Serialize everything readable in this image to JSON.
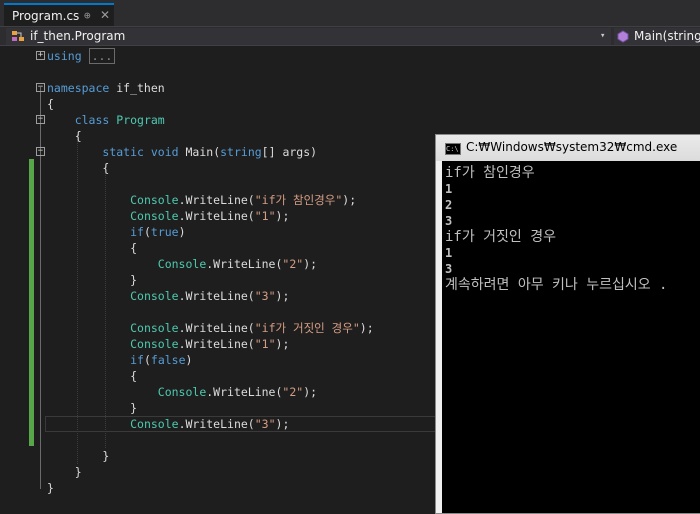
{
  "tab": {
    "title": "Program.cs",
    "pin_glyph": "⊕",
    "close_glyph": "✕"
  },
  "navbar": {
    "left_text": "if_then.Program",
    "right_text": "Main(string[]",
    "dropdown_glyph": "▾"
  },
  "editor": {
    "lines": [
      {
        "id": "l1",
        "parts": [
          [
            "kw",
            "using"
          ],
          [
            "plain",
            " "
          ],
          [
            "collapsed",
            "..."
          ]
        ]
      },
      {
        "id": "l2",
        "parts": []
      },
      {
        "id": "l3",
        "parts": [
          [
            "kw",
            "namespace"
          ],
          [
            "plain",
            " if_then"
          ]
        ]
      },
      {
        "id": "l4",
        "parts": [
          [
            "plain",
            "{"
          ]
        ]
      },
      {
        "id": "l5",
        "parts": [
          [
            "plain",
            "    "
          ],
          [
            "kw",
            "class"
          ],
          [
            "plain",
            " "
          ],
          [
            "cls",
            "Program"
          ]
        ]
      },
      {
        "id": "l6",
        "parts": [
          [
            "plain",
            "    {"
          ]
        ]
      },
      {
        "id": "l7",
        "parts": [
          [
            "plain",
            "        "
          ],
          [
            "kw",
            "static"
          ],
          [
            "plain",
            " "
          ],
          [
            "kw",
            "void"
          ],
          [
            "plain",
            " Main("
          ],
          [
            "kw",
            "string"
          ],
          [
            "plain",
            "[] args)"
          ]
        ]
      },
      {
        "id": "l8",
        "parts": [
          [
            "plain",
            "        {"
          ]
        ]
      },
      {
        "id": "l9",
        "parts": []
      },
      {
        "id": "l10",
        "parts": [
          [
            "plain",
            "            "
          ],
          [
            "cls",
            "Console"
          ],
          [
            "plain",
            ".WriteLine("
          ],
          [
            "str",
            "\"if가 참인경우\""
          ],
          [
            "plain",
            ");"
          ]
        ]
      },
      {
        "id": "l11",
        "parts": [
          [
            "plain",
            "            "
          ],
          [
            "cls",
            "Console"
          ],
          [
            "plain",
            ".WriteLine("
          ],
          [
            "str",
            "\"1\""
          ],
          [
            "plain",
            ");"
          ]
        ]
      },
      {
        "id": "l12",
        "parts": [
          [
            "plain",
            "            "
          ],
          [
            "kw",
            "if"
          ],
          [
            "plain",
            "("
          ],
          [
            "kw",
            "true"
          ],
          [
            "plain",
            ")"
          ]
        ]
      },
      {
        "id": "l13",
        "parts": [
          [
            "plain",
            "            {"
          ]
        ]
      },
      {
        "id": "l14",
        "parts": [
          [
            "plain",
            "                "
          ],
          [
            "cls",
            "Console"
          ],
          [
            "plain",
            ".WriteLine("
          ],
          [
            "str",
            "\"2\""
          ],
          [
            "plain",
            ");"
          ]
        ]
      },
      {
        "id": "l15",
        "parts": [
          [
            "plain",
            "            }"
          ]
        ]
      },
      {
        "id": "l16",
        "parts": [
          [
            "plain",
            "            "
          ],
          [
            "cls",
            "Console"
          ],
          [
            "plain",
            ".WriteLine("
          ],
          [
            "str",
            "\"3\""
          ],
          [
            "plain",
            ");"
          ]
        ]
      },
      {
        "id": "l17",
        "parts": []
      },
      {
        "id": "l18",
        "parts": [
          [
            "plain",
            "            "
          ],
          [
            "cls",
            "Console"
          ],
          [
            "plain",
            ".WriteLine("
          ],
          [
            "str",
            "\"if가 거짓인 경우\""
          ],
          [
            "plain",
            ");"
          ]
        ]
      },
      {
        "id": "l19",
        "parts": [
          [
            "plain",
            "            "
          ],
          [
            "cls",
            "Console"
          ],
          [
            "plain",
            ".WriteLine("
          ],
          [
            "str",
            "\"1\""
          ],
          [
            "plain",
            ");"
          ]
        ]
      },
      {
        "id": "l20",
        "parts": [
          [
            "plain",
            "            "
          ],
          [
            "kw",
            "if"
          ],
          [
            "plain",
            "("
          ],
          [
            "kw",
            "false"
          ],
          [
            "plain",
            ")"
          ]
        ]
      },
      {
        "id": "l21",
        "parts": [
          [
            "plain",
            "            {"
          ]
        ]
      },
      {
        "id": "l22",
        "parts": [
          [
            "plain",
            "                "
          ],
          [
            "cls",
            "Console"
          ],
          [
            "plain",
            ".WriteLine("
          ],
          [
            "str",
            "\"2\""
          ],
          [
            "plain",
            ");"
          ]
        ]
      },
      {
        "id": "l23",
        "parts": [
          [
            "plain",
            "            }"
          ]
        ]
      },
      {
        "id": "l24",
        "parts": [
          [
            "plain",
            "            "
          ],
          [
            "cls",
            "Console"
          ],
          [
            "plain",
            ".WriteLine("
          ],
          [
            "str",
            "\"3\""
          ],
          [
            "plain",
            ");"
          ]
        ]
      },
      {
        "id": "l25",
        "parts": []
      },
      {
        "id": "l26",
        "parts": [
          [
            "plain",
            "        }"
          ]
        ]
      },
      {
        "id": "l27",
        "parts": [
          [
            "plain",
            "    }"
          ]
        ]
      },
      {
        "id": "l28",
        "parts": [
          [
            "plain",
            "}"
          ]
        ]
      }
    ],
    "fold_glyphs": {
      "expanded": "−",
      "collapsed": "+"
    }
  },
  "console": {
    "title": "C:₩Windows₩system32₩cmd.exe",
    "icon_text": "C:\\",
    "lines": [
      {
        "text": "if가 참인경우",
        "bold": false
      },
      {
        "text": "1",
        "bold": true
      },
      {
        "text": "2",
        "bold": true
      },
      {
        "text": "3",
        "bold": true
      },
      {
        "text": "if가 거짓인 경우",
        "bold": false
      },
      {
        "text": "1",
        "bold": true
      },
      {
        "text": "3",
        "bold": true
      },
      {
        "text": "계속하려면 아무 키나 누르십시오 .",
        "bold": false
      }
    ]
  },
  "colors": {
    "keyword": "#569cd6",
    "type": "#4ec9b0",
    "string": "#d69d85",
    "text": "#dcdcdc",
    "change_bar": "#57a64a",
    "editor_bg": "#1e1e1e",
    "console_bg": "#000000"
  }
}
